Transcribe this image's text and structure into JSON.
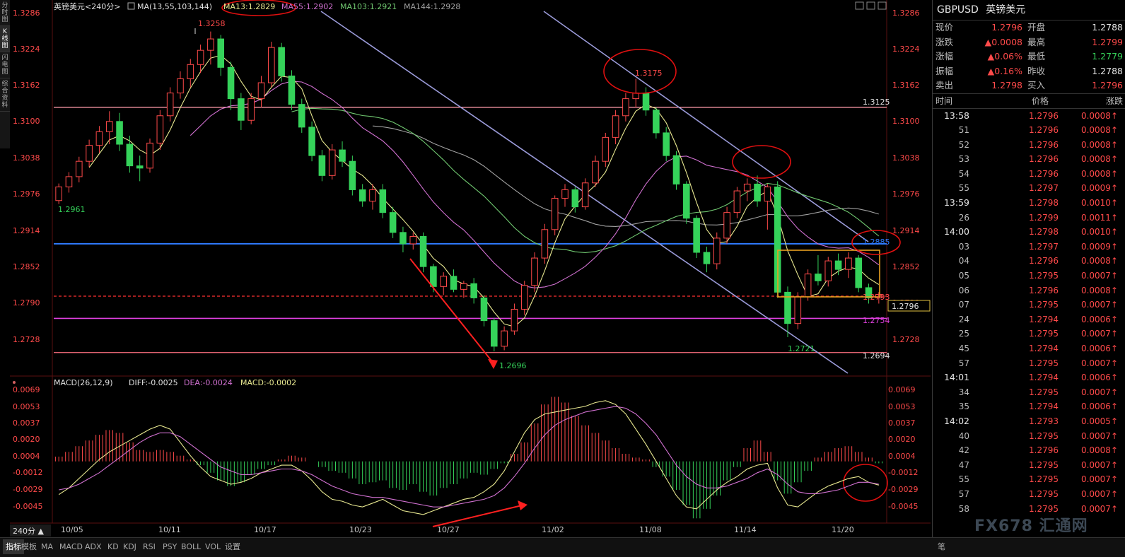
{
  "left_tabs": [
    "分时图",
    "K线图",
    "闪电图",
    "综合资料"
  ],
  "chart_header": {
    "instrument": "英镑美元<240分>",
    "ma_label": "MA(13,55,103,144)",
    "ma13": "MA13:1.2829",
    "ma55": "MA55:1.2902",
    "ma103": "MA103:1.2921",
    "ma144": "MA144:1.2928"
  },
  "macd_header": {
    "label": "MACD(26,12,9)",
    "diff": "DIFF:-0.0025",
    "dea": "DEA:-0.0024",
    "macd": "MACD:-0.0002"
  },
  "period_button": "240分 ▲",
  "colors": {
    "up": "#ff4a4a",
    "down": "#35d25a",
    "ma13": "#e8e890",
    "ma55": "#d070d0",
    "ma103": "#70c870",
    "ma144": "#a0a0a0",
    "blue_line": "#2f7bff",
    "pink_line": "#ff9aaa",
    "channel": "#9a9ad8"
  },
  "price_axis": [
    "1.3286",
    "1.3224",
    "1.3162",
    "1.3100",
    "1.3038",
    "1.2976",
    "1.2914",
    "1.2852",
    "1.2790",
    "1.2728"
  ],
  "macd_axis": [
    "0.0069",
    "0.0053",
    "0.0037",
    "0.0020",
    "0.0004",
    "-0.0012",
    "-0.0029",
    "-0.0045"
  ],
  "date_axis": [
    "10/05",
    "10/11",
    "10/17",
    "10/23",
    "10/27",
    "11/02",
    "11/08",
    "11/14",
    "11/20"
  ],
  "chart_annotations": {
    "high_1": "1.3258",
    "high_2": "1.3175",
    "start_low": "1.2961",
    "low_1": "1.2696",
    "low_2": "1.2721",
    "level_3125": "1.3125",
    "level_2885": "1.2885",
    "level_2793": "1.2793",
    "level_2754": "1.2754",
    "level_2694": "1.2694",
    "current_price": "1.2796"
  },
  "chart_data": {
    "type": "candlestick",
    "price_ylim": [
      1.268,
      1.3296
    ],
    "macd_ylim": [
      -0.0065,
      0.0078
    ],
    "candles": [
      [
        1.2961,
        1.2991,
        1.2955,
        1.2985
      ],
      [
        1.2985,
        1.3011,
        1.2975,
        1.3003
      ],
      [
        1.3003,
        1.3038,
        1.2993,
        1.303
      ],
      [
        1.303,
        1.3068,
        1.302,
        1.3058
      ],
      [
        1.3058,
        1.3092,
        1.3045,
        1.3082
      ],
      [
        1.3082,
        1.3118,
        1.306,
        1.31
      ],
      [
        1.31,
        1.3115,
        1.3048,
        1.306
      ],
      [
        1.306,
        1.3075,
        1.301,
        1.3022
      ],
      [
        1.3022,
        1.304,
        1.2995,
        1.3018
      ],
      [
        1.3018,
        1.307,
        1.301,
        1.3062
      ],
      [
        1.3062,
        1.312,
        1.305,
        1.311
      ],
      [
        1.311,
        1.316,
        1.31,
        1.315
      ],
      [
        1.315,
        1.3188,
        1.314,
        1.3175
      ],
      [
        1.3175,
        1.321,
        1.316,
        1.32
      ],
      [
        1.32,
        1.3235,
        1.3185,
        1.3225
      ],
      [
        1.3225,
        1.3258,
        1.32,
        1.3245
      ],
      [
        1.3245,
        1.3252,
        1.318,
        1.3195
      ],
      [
        1.3195,
        1.3205,
        1.312,
        1.314
      ],
      [
        1.314,
        1.315,
        1.3085,
        1.3102
      ],
      [
        1.3102,
        1.315,
        1.3095,
        1.314
      ],
      [
        1.314,
        1.318,
        1.3125,
        1.3168
      ],
      [
        1.3168,
        1.324,
        1.316,
        1.323
      ],
      [
        1.323,
        1.3238,
        1.317,
        1.318
      ],
      [
        1.318,
        1.319,
        1.312,
        1.313
      ],
      [
        1.313,
        1.314,
        1.308,
        1.309
      ],
      [
        1.309,
        1.31,
        1.303,
        1.304
      ],
      [
        1.304,
        1.305,
        1.2995,
        1.3005
      ],
      [
        1.3005,
        1.306,
        1.2998,
        1.305
      ],
      [
        1.305,
        1.3065,
        1.302,
        1.303
      ],
      [
        1.303,
        1.304,
        1.297,
        1.298
      ],
      [
        1.298,
        1.299,
        1.295,
        1.296
      ],
      [
        1.296,
        1.299,
        1.2945,
        1.298
      ],
      [
        1.298,
        1.299,
        1.293,
        1.294
      ],
      [
        1.294,
        1.295,
        1.2895,
        1.2905
      ],
      [
        1.2905,
        1.2915,
        1.287,
        1.2885
      ],
      [
        1.2885,
        1.2905,
        1.2875,
        1.2898
      ],
      [
        1.2898,
        1.2905,
        1.2835,
        1.2845
      ],
      [
        1.2845,
        1.285,
        1.28,
        1.281
      ],
      [
        1.281,
        1.2835,
        1.2795,
        1.2828
      ],
      [
        1.2828,
        1.284,
        1.28,
        1.2805
      ],
      [
        1.2805,
        1.282,
        1.279,
        1.2815
      ],
      [
        1.2815,
        1.2825,
        1.278,
        1.279
      ],
      [
        1.279,
        1.2795,
        1.274,
        1.275
      ],
      [
        1.275,
        1.2755,
        1.2696,
        1.2705
      ],
      [
        1.2705,
        1.274,
        1.2698,
        1.2732
      ],
      [
        1.2732,
        1.278,
        1.2725,
        1.277
      ],
      [
        1.277,
        1.282,
        1.276,
        1.2812
      ],
      [
        1.2812,
        1.287,
        1.28,
        1.286
      ],
      [
        1.286,
        1.292,
        1.285,
        1.291
      ],
      [
        1.291,
        1.297,
        1.29,
        1.2965
      ],
      [
        1.2965,
        1.299,
        1.295,
        1.298
      ],
      [
        1.298,
        1.2985,
        1.294,
        1.295
      ],
      [
        1.295,
        1.3,
        1.2945,
        1.2992
      ],
      [
        1.2992,
        1.304,
        1.2985,
        1.303
      ],
      [
        1.303,
        1.308,
        1.302,
        1.3072
      ],
      [
        1.3072,
        1.312,
        1.306,
        1.311
      ],
      [
        1.311,
        1.315,
        1.31,
        1.314
      ],
      [
        1.314,
        1.3175,
        1.3125,
        1.315
      ],
      [
        1.315,
        1.316,
        1.311,
        1.312
      ],
      [
        1.312,
        1.3125,
        1.307,
        1.308
      ],
      [
        1.308,
        1.309,
        1.303,
        1.304
      ],
      [
        1.304,
        1.3048,
        1.298,
        1.299
      ],
      [
        1.299,
        1.2995,
        1.292,
        1.293
      ],
      [
        1.293,
        1.2935,
        1.286,
        1.287
      ],
      [
        1.287,
        1.288,
        1.2835,
        1.285
      ],
      [
        1.285,
        1.2905,
        1.284,
        1.2895
      ],
      [
        1.2895,
        1.295,
        1.2885,
        1.294
      ],
      [
        1.294,
        1.2985,
        1.293,
        1.2978
      ],
      [
        1.2978,
        1.3,
        1.296,
        1.299
      ],
      [
        1.299,
        1.3005,
        1.295,
        1.296
      ],
      [
        1.296,
        1.299,
        1.291,
        1.2985
      ],
      [
        1.2985,
        1.2995,
        1.279,
        1.28
      ],
      [
        1.28,
        1.281,
        1.2721,
        1.2745
      ],
      [
        1.2745,
        1.28,
        1.2735,
        1.2792
      ],
      [
        1.2792,
        1.284,
        1.2785,
        1.2832
      ],
      [
        1.2832,
        1.2865,
        1.2812,
        1.282
      ],
      [
        1.282,
        1.2862,
        1.281,
        1.2855
      ],
      [
        1.2855,
        1.2868,
        1.283,
        1.284
      ],
      [
        1.284,
        1.287,
        1.2825,
        1.286
      ],
      [
        1.286,
        1.2865,
        1.28,
        1.2808
      ],
      [
        1.2808,
        1.2815,
        1.278,
        1.279
      ],
      [
        1.279,
        1.28,
        1.278,
        1.2796
      ]
    ],
    "macd_hist": [
      0.0005,
      0.001,
      0.0016,
      0.0022,
      0.0028,
      0.0033,
      0.003,
      0.002,
      0.0012,
      0.001,
      0.0012,
      0.001,
      0.0006,
      0.0002,
      -0.0004,
      -0.0012,
      -0.002,
      -0.0026,
      -0.0022,
      -0.0014,
      -0.0008,
      -0.0004,
      0.0002,
      0.0006,
      0.0004,
      0.0,
      -0.0006,
      -0.001,
      -0.0012,
      -0.0018,
      -0.0024,
      -0.0022,
      -0.002,
      -0.0028,
      -0.003,
      -0.0024,
      -0.0032,
      -0.0036,
      -0.0028,
      -0.0024,
      -0.0018,
      -0.0012,
      -0.0014,
      -0.0008,
      -0.0002,
      0.0008,
      0.002,
      0.004,
      0.006,
      0.0068,
      0.0062,
      0.0048,
      0.0038,
      0.003,
      0.0022,
      0.0014,
      0.0008,
      0.0004,
      0.0002,
      -0.0006,
      -0.0016,
      -0.003,
      -0.0046,
      -0.006,
      -0.005,
      -0.0036,
      -0.002,
      -0.0006,
      0.0014,
      0.0022,
      0.001,
      -0.002,
      -0.0034,
      -0.0022,
      -0.001,
      0.0004,
      0.001,
      0.0014,
      0.0016,
      0.001,
      0.0004,
      -0.0002
    ],
    "diff": [
      -0.0035,
      -0.0028,
      -0.0018,
      -0.0008,
      0.0002,
      0.001,
      0.0016,
      0.0022,
      0.0028,
      0.0034,
      0.0038,
      0.0034,
      0.002,
      0.0006,
      -0.0006,
      -0.0016,
      -0.002,
      -0.0024,
      -0.0022,
      -0.0018,
      -0.0012,
      -0.0008,
      -0.0004,
      -0.0004,
      -0.001,
      -0.002,
      -0.0032,
      -0.004,
      -0.0042,
      -0.0046,
      -0.0048,
      -0.0044,
      -0.004,
      -0.0046,
      -0.0052,
      -0.0054,
      -0.0056,
      -0.0052,
      -0.0048,
      -0.0044,
      -0.004,
      -0.0038,
      -0.0032,
      -0.0024,
      -0.001,
      0.001,
      0.003,
      0.0044,
      0.005,
      0.0052,
      0.0054,
      0.0056,
      0.0058,
      0.0062,
      0.0064,
      0.006,
      0.005,
      0.0034,
      0.0018,
      0.0,
      -0.0018,
      -0.0036,
      -0.0048,
      -0.005,
      -0.004,
      -0.003,
      -0.0022,
      -0.0016,
      -0.0008,
      -0.0004,
      -0.0002,
      -0.0028,
      -0.0046,
      -0.0048,
      -0.004,
      -0.0032,
      -0.0026,
      -0.0022,
      -0.0018,
      -0.0016,
      -0.0022,
      -0.0025
    ],
    "dea": [
      -0.003,
      -0.0028,
      -0.0024,
      -0.0018,
      -0.0012,
      -0.0004,
      0.0004,
      0.0012,
      0.002,
      0.0026,
      0.003,
      0.003,
      0.0026,
      0.0018,
      0.001,
      0.0002,
      -0.0006,
      -0.001,
      -0.0014,
      -0.0014,
      -0.0012,
      -0.001,
      -0.0008,
      -0.0008,
      -0.001,
      -0.0014,
      -0.002,
      -0.0026,
      -0.003,
      -0.0034,
      -0.0036,
      -0.0038,
      -0.0038,
      -0.004,
      -0.0042,
      -0.0044,
      -0.0046,
      -0.0048,
      -0.0048,
      -0.0046,
      -0.0044,
      -0.0042,
      -0.004,
      -0.0036,
      -0.0028,
      -0.0016,
      -0.0002,
      0.0014,
      0.0028,
      0.0038,
      0.0044,
      0.0048,
      0.0052,
      0.0054,
      0.0056,
      0.0058,
      0.0056,
      0.005,
      0.004,
      0.0028,
      0.0012,
      -0.0004,
      -0.0016,
      -0.0024,
      -0.0028,
      -0.0028,
      -0.0026,
      -0.0022,
      -0.0018,
      -0.0012,
      -0.0008,
      -0.0014,
      -0.0024,
      -0.0032,
      -0.0034,
      -0.0034,
      -0.0032,
      -0.003,
      -0.0026,
      -0.0022,
      -0.0022,
      -0.0024
    ]
  },
  "quote": {
    "title_code": "GBPUSD",
    "title_name": "英镑美元",
    "rows": [
      {
        "l1": "现价",
        "v1": "1.2796",
        "l2": "开盘",
        "v2": "1.2788",
        "v2class": "white"
      },
      {
        "l1": "涨跌",
        "v1": "▲0.0008",
        "l2": "最高",
        "v2": "1.2799"
      },
      {
        "l1": "涨幅",
        "v1": "▲0.06%",
        "l2": "最低",
        "v2": "1.2779",
        "v2class": "green"
      },
      {
        "l1": "振幅",
        "v1": "▲0.16%",
        "l2": "昨收",
        "v2": "1.2788",
        "v2class": "white"
      },
      {
        "l1": "卖出",
        "v1": "1.2798",
        "l2": "买入",
        "v2": "1.2796"
      }
    ],
    "ticks_header": {
      "time": "时间",
      "price": "价格",
      "change": "涨跌"
    },
    "ticks": [
      {
        "t": "13:58",
        "big": true,
        "p": "1.2796",
        "c": "0.0008↑"
      },
      {
        "t": "51",
        "p": "1.2796",
        "c": "0.0008↑"
      },
      {
        "t": "52",
        "p": "1.2796",
        "c": "0.0008↑"
      },
      {
        "t": "53",
        "p": "1.2796",
        "c": "0.0008↑"
      },
      {
        "t": "54",
        "p": "1.2796",
        "c": "0.0008↑"
      },
      {
        "t": "55",
        "p": "1.2797",
        "c": "0.0009↑"
      },
      {
        "t": "13:59",
        "big": true,
        "p": "1.2798",
        "c": "0.0010↑"
      },
      {
        "t": "26",
        "p": "1.2799",
        "c": "0.0011↑"
      },
      {
        "t": "14:00",
        "big": true,
        "p": "1.2798",
        "c": "0.0010↑"
      },
      {
        "t": "03",
        "p": "1.2797",
        "c": "0.0009↑"
      },
      {
        "t": "04",
        "p": "1.2796",
        "c": "0.0008↑"
      },
      {
        "t": "05",
        "p": "1.2795",
        "c": "0.0007↑"
      },
      {
        "t": "06",
        "p": "1.2796",
        "c": "0.0008↑"
      },
      {
        "t": "07",
        "p": "1.2795",
        "c": "0.0007↑"
      },
      {
        "t": "24",
        "p": "1.2794",
        "c": "0.0006↑"
      },
      {
        "t": "25",
        "p": "1.2795",
        "c": "0.0007↑"
      },
      {
        "t": "45",
        "p": "1.2794",
        "c": "0.0006↑"
      },
      {
        "t": "57",
        "p": "1.2795",
        "c": "0.0007↑"
      },
      {
        "t": "14:01",
        "big": true,
        "p": "1.2794",
        "c": "0.0006↑"
      },
      {
        "t": "34",
        "p": "1.2795",
        "c": "0.0007↑"
      },
      {
        "t": "35",
        "p": "1.2794",
        "c": "0.0006↑"
      },
      {
        "t": "14:02",
        "big": true,
        "p": "1.2793",
        "c": "0.0005↑"
      },
      {
        "t": "40",
        "p": "1.2795",
        "c": "0.0007↑"
      },
      {
        "t": "42",
        "p": "1.2796",
        "c": "0.0008↑"
      },
      {
        "t": "47",
        "p": "1.2795",
        "c": "0.0007↑"
      },
      {
        "t": "55",
        "p": "1.2795",
        "c": "0.0007↑"
      },
      {
        "t": "57",
        "p": "1.2795",
        "c": "0.0007↑"
      },
      {
        "t": "58",
        "p": "1.2795",
        "c": "0.0007↑"
      }
    ]
  },
  "bottom_tabs": [
    "指标",
    "模板",
    "MA",
    "MACD",
    "ADX",
    "KD",
    "KDJ",
    "RSI",
    "PSY",
    "BOLL",
    "VOL",
    "设置"
  ],
  "bottom_right_tab": "笔",
  "watermark": "FX678 汇通网"
}
